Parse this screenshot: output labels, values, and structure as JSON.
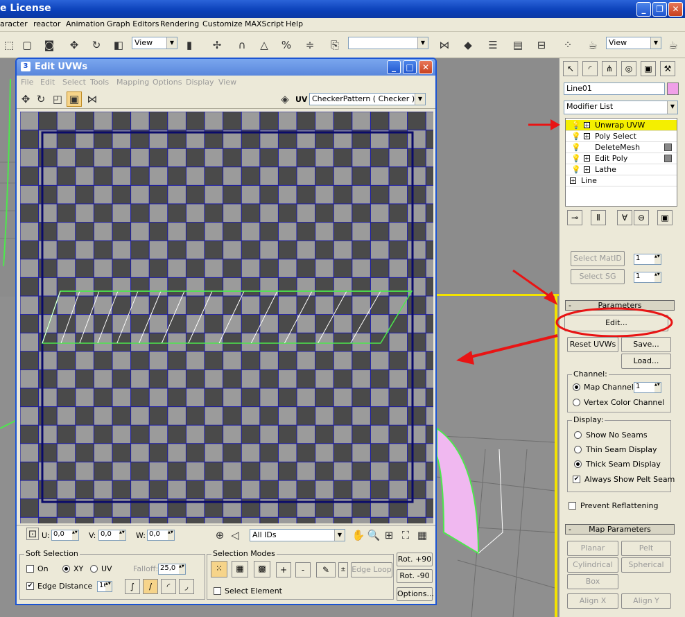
{
  "app": {
    "title": "e License",
    "menu": [
      "aracter",
      "reactor",
      "Animation",
      "Graph Editors",
      "Rendering",
      "Customize",
      "MAXScript",
      "Help"
    ],
    "toolbar": {
      "view_combo": "View",
      "view_combo_right": "View"
    }
  },
  "uvw": {
    "title": "Edit UVWs",
    "menu": [
      "File",
      "Edit",
      "Select",
      "Tools",
      "Mapping",
      "Options",
      "Display",
      "View"
    ],
    "uv_label": "UV",
    "texture_combo": "CheckerPattern  ( Checker )",
    "bottom": {
      "u_label": "U:",
      "u_value": "0,0",
      "v_label": "V:",
      "v_value": "0,0",
      "w_label": "W:",
      "w_value": "0,0",
      "ids_combo": "All IDs"
    },
    "soft_selection": {
      "title": "Soft Selection",
      "on_label": "On",
      "xy_label": "XY",
      "uv_label": "UV",
      "falloff_label": "Falloff:",
      "falloff_value": "25,0",
      "edge_distance_label": "Edge Distance",
      "edge_distance_value": "16"
    },
    "selection_modes": {
      "title": "Selection Modes",
      "plus_label": "+",
      "minus_label": "-",
      "edge_loop_label": "Edge Loop",
      "select_element_label": "Select Element"
    },
    "rot_plus_label": "Rot. +90",
    "rot_minus_label": "Rot. -90",
    "options_label": "Options..."
  },
  "command_panel": {
    "object_name": "Line01",
    "modifier_list": "Modifier List",
    "stack": [
      {
        "label": "Unwrap UVW",
        "selected": true
      },
      {
        "label": "Poly Select",
        "selected": false
      },
      {
        "label": "DeleteMesh",
        "selected": false
      },
      {
        "label": "Edit Poly",
        "selected": false
      },
      {
        "label": "Lathe",
        "selected": false
      },
      {
        "label": "Line",
        "selected": false
      }
    ],
    "select_matid_label": "Select MatID",
    "select_sg_label": "Select SG",
    "matid_value": "1",
    "sg_value": "1",
    "parameters_title": "Parameters",
    "edit_label": "Edit...",
    "reset_uvws_label": "Reset UVWs",
    "save_label": "Save...",
    "load_label": "Load...",
    "channel_title": "Channel:",
    "map_channel_label": "Map Channel:",
    "map_channel_value": "1",
    "vertex_color_label": "Vertex Color Channel",
    "display_title": "Display:",
    "show_no_seams_label": "Show No Seams",
    "thin_seam_label": "Thin Seam Display",
    "thick_seam_label": "Thick Seam Display",
    "pelt_seam_label": "Always Show Pelt Seam",
    "prevent_reflatten_label": "Prevent Reflattening",
    "map_parameters_title": "Map Parameters",
    "map_buttons": [
      "Planar",
      "Pelt",
      "Cylindrical",
      "Spherical",
      "Box",
      "Align X",
      "Align Y"
    ]
  },
  "colors": {
    "accent_red": "#e81414",
    "highlight_yellow": "#f4ef00",
    "uv_green": "#4de84d",
    "grid_blue": "#1a1aa8"
  }
}
